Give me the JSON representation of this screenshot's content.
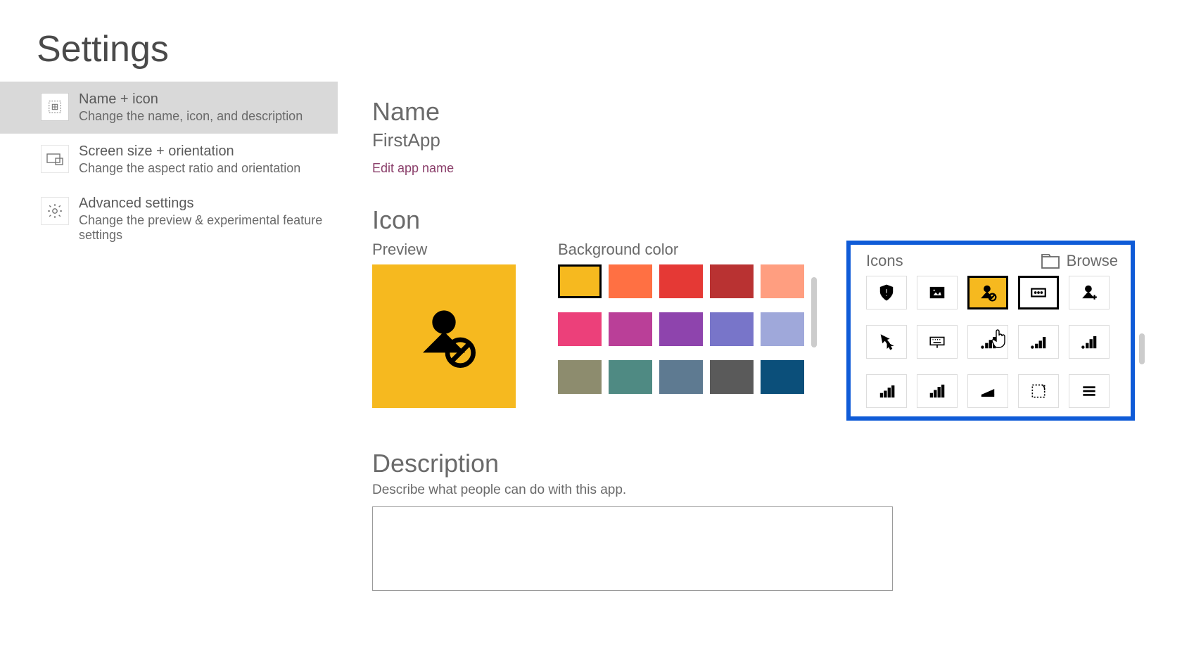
{
  "page_title": "Settings",
  "sidebar": {
    "items": [
      {
        "title": "Name + icon",
        "sub": "Change the name, icon, and description",
        "icon": "grid-icon",
        "active": true
      },
      {
        "title": "Screen size + orientation",
        "sub": "Change the aspect ratio and orientation",
        "icon": "screen-icon",
        "active": false
      },
      {
        "title": "Advanced settings",
        "sub": "Change the preview & experimental feature settings",
        "icon": "gear-icon",
        "active": false
      }
    ]
  },
  "name_section": {
    "heading": "Name",
    "value": "FirstApp",
    "edit_link": "Edit app name"
  },
  "icon_section": {
    "heading": "Icon",
    "preview_label": "Preview",
    "bg_label": "Background color",
    "icons_label": "Icons",
    "browse_label": "Browse",
    "preview_bg": "#f6b91f",
    "bg_colors": [
      "#f6b91f",
      "#ff7043",
      "#e53935",
      "#b93232",
      "#ff9e80",
      "#ec407a",
      "#ba3f98",
      "#8e44ad",
      "#7875c9",
      "#9fa8da",
      "#8d8c6e",
      "#4f8a83",
      "#5e7a91",
      "#5a5a5a",
      "#0b4f7a"
    ],
    "bg_selected_index": 0,
    "icons": [
      {
        "name": "shield-alert-icon"
      },
      {
        "name": "picture-swap-icon"
      },
      {
        "name": "user-block-icon"
      },
      {
        "name": "card-icon"
      },
      {
        "name": "user-add-icon"
      },
      {
        "name": "cursor-click-icon"
      },
      {
        "name": "keyboard-icon"
      },
      {
        "name": "bars-1-icon"
      },
      {
        "name": "bars-2-icon"
      },
      {
        "name": "bars-3-icon"
      },
      {
        "name": "bars-4-icon"
      },
      {
        "name": "bars-5-icon"
      },
      {
        "name": "scanner-icon"
      },
      {
        "name": "select-dashed-icon"
      },
      {
        "name": "menu-lines-icon"
      }
    ],
    "icon_selected_index": 2,
    "icon_hover_index": 3
  },
  "description_section": {
    "heading": "Description",
    "hint": "Describe what people can do with this app.",
    "value": ""
  }
}
